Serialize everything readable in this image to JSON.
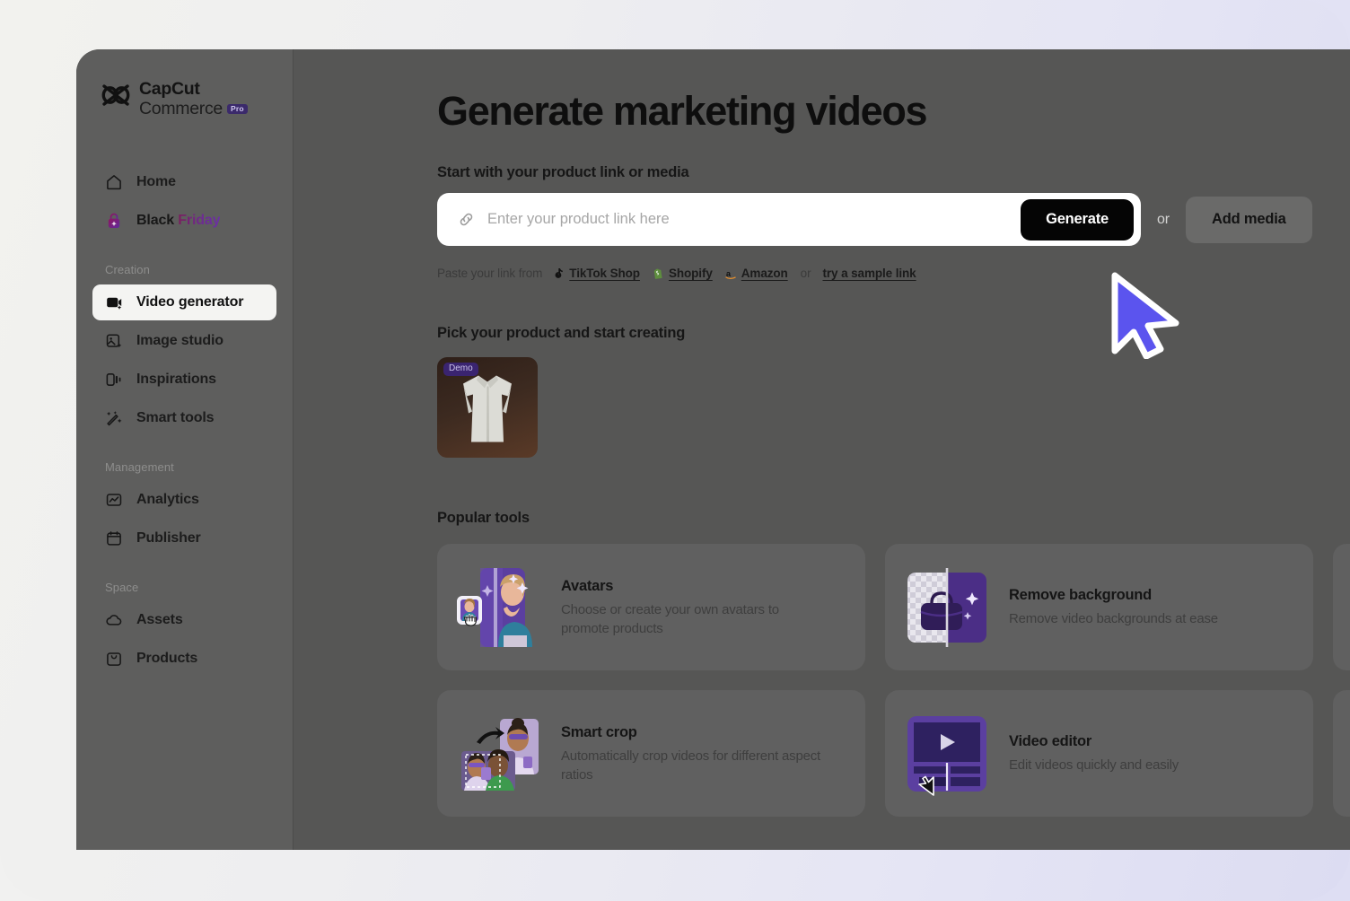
{
  "brand": {
    "logo_line1": "CapCut",
    "logo_line2": "Commerce",
    "pro_badge": "Pro",
    "logo_icon": "capcut-logo-icon"
  },
  "sidebar": {
    "top_items": [
      {
        "label": "Home",
        "icon": "home-icon"
      },
      {
        "label_part1": "Black ",
        "label_part2": "Friday",
        "icon": "lock-bag-icon"
      }
    ],
    "groups": [
      {
        "title": "Creation",
        "items": [
          {
            "label": "Video generator",
            "icon": "video-generator-icon",
            "active": true
          },
          {
            "label": "Image studio",
            "icon": "image-studio-icon",
            "active": false
          },
          {
            "label": "Inspirations",
            "icon": "inspirations-icon",
            "active": false
          },
          {
            "label": "Smart tools",
            "icon": "smart-tools-icon",
            "active": false
          }
        ]
      },
      {
        "title": "Management",
        "items": [
          {
            "label": "Analytics",
            "icon": "analytics-icon",
            "active": false
          },
          {
            "label": "Publisher",
            "icon": "publisher-calendar-icon",
            "active": false
          }
        ]
      },
      {
        "title": "Space",
        "items": [
          {
            "label": "Assets",
            "icon": "cloud-icon",
            "active": false
          },
          {
            "label": "Products",
            "icon": "products-bag-icon",
            "active": false
          }
        ]
      }
    ]
  },
  "main": {
    "page_title": "Generate marketing videos",
    "start_section_label": "Start with your product link or media",
    "search": {
      "placeholder": "Enter your product link here",
      "value": "",
      "link_icon": "link-chain-icon",
      "generate_label": "Generate",
      "or_label": "or",
      "add_media_label": "Add media"
    },
    "paste_from": {
      "lead": "Paste your link from",
      "sources": [
        {
          "label": "TikTok Shop",
          "icon": "tiktok-icon"
        },
        {
          "label": "Shopify",
          "icon": "shopify-bag-icon"
        },
        {
          "label": "Amazon",
          "icon": "amazon-a-icon"
        }
      ],
      "mid_or": "or",
      "sample_link": "try a sample link"
    },
    "product_section": {
      "label": "Pick your product and start creating",
      "products": [
        {
          "badge": "Demo",
          "alt": "white dress shirt product thumbnail"
        }
      ]
    },
    "tools_section": {
      "label": "Popular tools",
      "tools": [
        {
          "title": "Avatars",
          "desc": "Choose or create your own avatars to promote products",
          "icon": "avatars-thumb"
        },
        {
          "title": "Remove background",
          "desc": "Remove video backgrounds at ease",
          "icon": "remove-background-thumb"
        },
        {
          "title": "Smart crop",
          "desc": "Automatically crop videos for different aspect ratios",
          "icon": "smart-crop-thumb"
        },
        {
          "title": "Video editor",
          "desc": "Edit videos quickly and easily",
          "icon": "video-editor-thumb"
        }
      ]
    }
  },
  "cursor": {
    "icon": "mouse-pointer-icon",
    "color": "#5b54ee"
  },
  "colors": {
    "accent_purple": "#5b54ee",
    "dark_button": "#050505",
    "pro_badge_bg": "#3b2a6b"
  }
}
